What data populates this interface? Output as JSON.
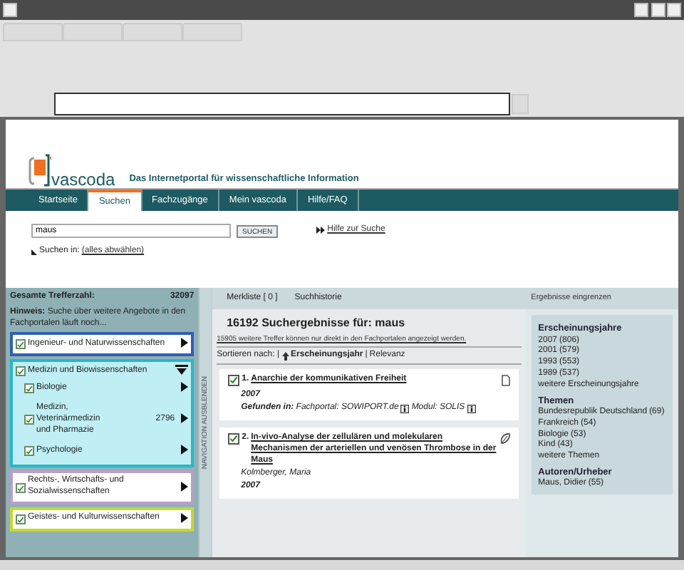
{
  "site": {
    "logo_text": "vascoda",
    "tagline": "Das Internetportal für wissenschaftliche Information"
  },
  "nav_tabs": [
    {
      "label": "Startseite",
      "selected": false
    },
    {
      "label": "Suchen",
      "selected": true
    },
    {
      "label": "Fachzugänge",
      "selected": false
    },
    {
      "label": "Mein vascoda",
      "selected": false
    },
    {
      "label": "Hilfe/FAQ",
      "selected": false
    }
  ],
  "search": {
    "value": "maus",
    "button": "SUCHEN",
    "help_link": "Hilfe zur Suche",
    "scope_label": "Suchen in:",
    "scope_link": "(alles abwählen)"
  },
  "sidebar": {
    "total_label": "Gesamte Trefferzahl:",
    "total": "32097",
    "hint": "**Hinweis:** Suche über weitere Angebote in den Fachportalen läuft noch...",
    "toggle": "NAVIGATION AUSBLENDEN",
    "categories": [
      {
        "label": "Ingenieur- und Naturwissenschaften",
        "checked": true,
        "expanded": false,
        "color": "#2f5fb3"
      },
      {
        "label": "Medizin und Biowissenschaften",
        "checked": true,
        "expanded": true,
        "color": "#2bb5c9",
        "children": [
          {
            "label": "Biologie",
            "checked": true
          },
          {
            "label": "Medizin, Veterinärmedizin und Pharmazie",
            "checked": true,
            "count": "2796"
          },
          {
            "label": "Psychologie",
            "checked": true
          }
        ]
      },
      {
        "label": "Rechts-, Wirtschafts- und Sozialwissenschaften",
        "checked": true,
        "expanded": false,
        "color": "#b8a0c8"
      },
      {
        "label": "Geistes- und Kulturwissenschaften",
        "checked": true,
        "expanded": false,
        "color": "#c8d830"
      }
    ]
  },
  "results_tabs": [
    "Merkliste [ 0 ]",
    "Suchhistorie"
  ],
  "results": {
    "heading": "16192 Suchergebnisse für: maus",
    "more_link": "15905 weitere Treffer können nur direkt in den Fachportalen angezeigt werden.",
    "sort_label": "Sortieren nach: |",
    "sort_separator": "|",
    "sort_options": [
      {
        "label": "Erscheinungsjahr",
        "selected": true
      },
      {
        "label": "Relevanz",
        "selected": false
      }
    ],
    "items": [
      {
        "number": "1.",
        "checked": true,
        "kind": "page",
        "title": "Anarchie der kommunikativen Freiheit",
        "year": "2007",
        "found": [
          "**Gefunden in:** Fachportal: SOWIPORT.de",
          "Modul: SOLIS"
        ]
      },
      {
        "number": "2.",
        "checked": true,
        "kind": "leaf",
        "title": "In-vivo-Analyse der zellulären und molekularen Mechanismen der arteriellen und venösen Thrombose in der Maus",
        "author": "Kolmberger, Maria",
        "year": "2007"
      }
    ]
  },
  "refine": {
    "title": "Ergebnisse eingrenzen",
    "groups": [
      {
        "title": "Erscheinungsjahre",
        "items": [
          {
            "label": "2007",
            "count": "(806)"
          },
          {
            "label": "2001",
            "count": "(579)"
          },
          {
            "label": "1993",
            "count": "(553)"
          },
          {
            "label": "1989",
            "count": "(537)"
          },
          {
            "label": "weitere Erscheinungsjahre"
          }
        ]
      },
      {
        "title": "Themen",
        "items": [
          {
            "label": "Bundesrepublik Deutschland",
            "count": "(69)"
          },
          {
            "label": "Frankreich",
            "count": "(54)"
          },
          {
            "label": "Biologie",
            "count": "(53)"
          },
          {
            "label": "Kind",
            "count": "(43)"
          },
          {
            "label": "weitere Themen"
          }
        ]
      },
      {
        "title": "Autoren/Urheber",
        "items": [
          {
            "label": "Maus, Didier",
            "count": "(55)"
          }
        ]
      }
    ]
  }
}
